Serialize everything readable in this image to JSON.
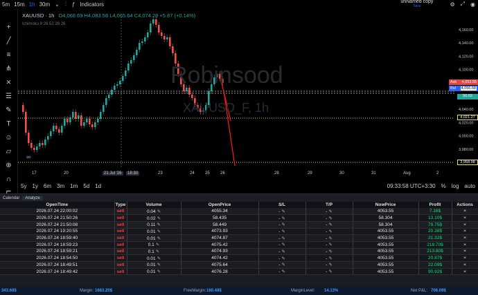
{
  "toolbar": {
    "timeframes": [
      "5m",
      "15m",
      "1h",
      "30m"
    ],
    "indicators_label": "Indicators",
    "layout_name": "unNamed copy",
    "save_label": "Save"
  },
  "legend": {
    "symbol": "XAUUSD · 1h",
    "open": "4,068.69",
    "high": "4,083.58",
    "low": "4,065.64",
    "close": "4,074.28",
    "change": "+5.87 (+0.14%)",
    "indicator": "Ichimoku 9 26 52 26 26"
  },
  "watermark": {
    "brand": "Robinsood",
    "symbol": "XAUUSD_F, 1h"
  },
  "price_axis": {
    "ticks": [
      "4,160.00",
      "4,140.00",
      "4,120.00",
      "4,100.00",
      "4,080.00",
      "4,060.00",
      "4,040.00",
      "4,020.00",
      "4,000.00",
      "3,980.00"
    ],
    "ask_label": "Ask",
    "ask_price": "4,053.55",
    "bid_label": "Bid",
    "bid_price": "4,056.68",
    "countdown": "56:02",
    "line_price": "4,021.27",
    "low_price": "3,958.98"
  },
  "time_axis": {
    "labels": [
      "17",
      "20",
      "21 Jul '26",
      "18:30",
      "23",
      "24",
      "25",
      "26",
      "28",
      "29",
      "30",
      "31",
      "Aug",
      "2"
    ]
  },
  "bottombar": {
    "ranges": [
      "5y",
      "1y",
      "6m",
      "3m",
      "1m",
      "5d",
      "1d"
    ],
    "clock": "09:33:58 UTC+3:30",
    "scale_pct": "%",
    "scale_log": "log",
    "scale_auto": "auto"
  },
  "panel_tabs": [
    "Calendar",
    "Analyze"
  ],
  "table": {
    "headers": [
      "OpenTime",
      "Type",
      "Volume",
      "OpenPrice",
      "S/L",
      "T/P",
      "NowPrice",
      "Profit",
      "Actions"
    ],
    "rows": [
      {
        "time": "2026.07.24 22:00:02",
        "type": "sell",
        "volume": "0.04",
        "open": "4055.34",
        "sl": "-",
        "tp": "-",
        "now": "4053.55",
        "profit": "7.16$"
      },
      {
        "time": "2026.07.24 21:50:26",
        "type": "sell",
        "volume": "0.02",
        "open": "58.435",
        "sl": "-",
        "tp": "-",
        "now": "58.304",
        "profit": "13.10$"
      },
      {
        "time": "2026.07.24 21:50:08",
        "type": "sell",
        "volume": "0.11",
        "open": "58.449",
        "sl": "-",
        "tp": "-",
        "now": "58.304",
        "profit": "79.75$"
      },
      {
        "time": "2026.07.24 19:20:55",
        "type": "sell",
        "volume": "0.01",
        "open": "4073.93",
        "sl": "-",
        "tp": "-",
        "now": "4053.55",
        "profit": "20.38$"
      },
      {
        "time": "2026.07.24 18:59:40",
        "type": "sell",
        "volume": "0.01",
        "open": "4074.87",
        "sl": "-",
        "tp": "-",
        "now": "4053.55",
        "profit": "21.32$"
      },
      {
        "time": "2026.07.24 18:59:23",
        "type": "sell",
        "volume": "0.1",
        "open": "4075.42",
        "sl": "-",
        "tp": "-",
        "now": "4053.55",
        "profit": "218.70$"
      },
      {
        "time": "2026.07.24 18:59:21",
        "type": "sell",
        "volume": "0.1",
        "open": "4074.93",
        "sl": "-",
        "tp": "-",
        "now": "4053.55",
        "profit": "213.80$"
      },
      {
        "time": "2026.07.24 18:54:50",
        "type": "sell",
        "volume": "0.01",
        "open": "4074.42",
        "sl": "-",
        "tp": "-",
        "now": "4053.55",
        "profit": "20.87$"
      },
      {
        "time": "2026.07.24 18:49:51",
        "type": "sell",
        "volume": "0.01",
        "open": "4075.64",
        "sl": "-",
        "tp": "-",
        "now": "4053.55",
        "profit": "22.09$"
      },
      {
        "time": "2026.07.24 18:49:42",
        "type": "sell",
        "volume": "0.01",
        "open": "4076.28",
        "sl": "-",
        "tp": "-",
        "now": "4053.55",
        "profit": "90.92$"
      }
    ],
    "action_symbol": "×"
  },
  "footer": {
    "balance_value": "343.68$",
    "margin_label": "Margin:",
    "margin_value": "1683.20$",
    "free_label": "FreeMargin:",
    "free_value": "160.48$",
    "level_label": "MarginLevel:",
    "level_value": "14.13%",
    "pnl_label": "Net P&L:",
    "pnl_value": "708.09$"
  }
}
